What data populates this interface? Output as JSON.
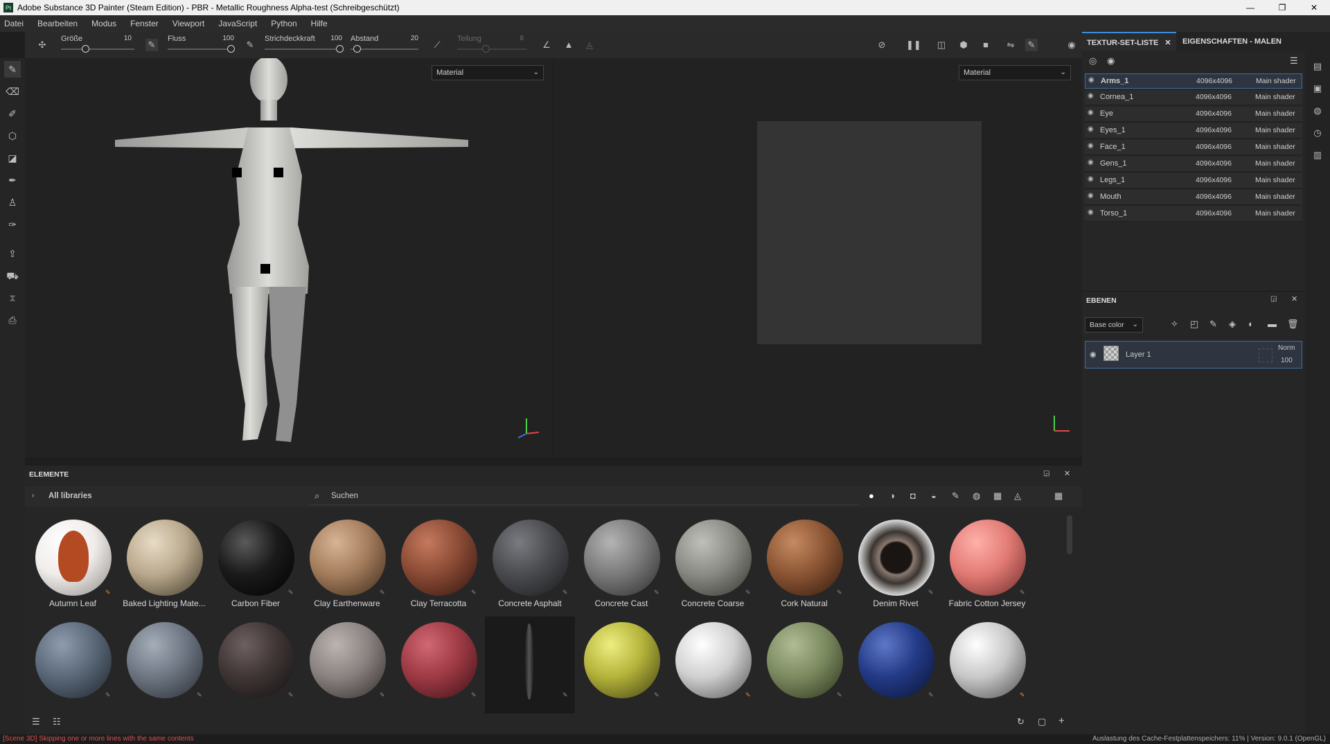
{
  "window": {
    "app_icon": "Pt",
    "title": "Adobe Substance 3D Painter (Steam Edition) - PBR - Metallic Roughness Alpha-test (Schreibgeschützt)",
    "controls": [
      "—",
      "❐",
      "✕"
    ]
  },
  "menu": [
    "Datei",
    "Bearbeiten",
    "Modus",
    "Fenster",
    "Viewport",
    "JavaScript",
    "Python",
    "Hilfe"
  ],
  "toolbar": {
    "size_label": "Größe",
    "size_value": "10",
    "flow_label": "Fluss",
    "flow_value": "100",
    "opacity_label": "Strichdeckkraft",
    "opacity_value": "100",
    "spacing_label": "Abstand",
    "spacing_value": "20",
    "division_label": "Teilung",
    "division_value": "8"
  },
  "viewport3d": {
    "material_select": "Material"
  },
  "viewport2d": {
    "material_select": "Material"
  },
  "texture_set_list": {
    "tab_label": "TEXTUR-SET-LISTE",
    "properties_tab_label": "EIGENSCHAFTEN - MALEN",
    "rows": [
      {
        "name": "Arms_1",
        "resolution": "4096x4096",
        "shader": "Main shader",
        "selected": true
      },
      {
        "name": "Cornea_1",
        "resolution": "4096x4096",
        "shader": "Main shader",
        "selected": false
      },
      {
        "name": "Eye",
        "resolution": "4096x4096",
        "shader": "Main shader",
        "selected": false
      },
      {
        "name": "Eyes_1",
        "resolution": "4096x4096",
        "shader": "Main shader",
        "selected": false
      },
      {
        "name": "Face_1",
        "resolution": "4096x4096",
        "shader": "Main shader",
        "selected": false
      },
      {
        "name": "Gens_1",
        "resolution": "4096x4096",
        "shader": "Main shader",
        "selected": false
      },
      {
        "name": "Legs_1",
        "resolution": "4096x4096",
        "shader": "Main shader",
        "selected": false
      },
      {
        "name": "Mouth",
        "resolution": "4096x4096",
        "shader": "Main shader",
        "selected": false
      },
      {
        "name": "Torso_1",
        "resolution": "4096x4096",
        "shader": "Main shader",
        "selected": false
      }
    ]
  },
  "layers": {
    "header": "EBENEN",
    "channel_select": "Base color",
    "items": [
      {
        "name": "Layer 1",
        "blend": "Norm",
        "opacity": "100"
      }
    ]
  },
  "assets": {
    "header": "ELEMENTE",
    "library": "All libraries",
    "search_placeholder": "Suchen",
    "row1": [
      {
        "name": "Autumn Leaf",
        "color": "#f0ecea",
        "accent": "#b44a22",
        "badge": "orange"
      },
      {
        "name": "Baked Lighting Mate...",
        "color": "#b9a88c",
        "badge": "none"
      },
      {
        "name": "Carbon Fiber",
        "color": "#1a1a1a",
        "badge": "gray"
      },
      {
        "name": "Clay Earthenware",
        "color": "#a37c5c",
        "badge": "gray"
      },
      {
        "name": "Clay Terracotta",
        "color": "#8a4a34",
        "badge": "gray"
      },
      {
        "name": "Concrete Asphalt",
        "color": "#4a4b4f",
        "badge": "gray"
      },
      {
        "name": "Concrete Cast",
        "color": "#7a7a7a",
        "badge": "gray"
      },
      {
        "name": "Concrete Coarse",
        "color": "#8a8a84",
        "badge": "gray"
      },
      {
        "name": "Cork Natural",
        "color": "#8b5534",
        "badge": "gray"
      },
      {
        "name": "Denim Rivet",
        "color": "#3a3430",
        "badge": "gray"
      },
      {
        "name": "Fabric Cotton Jersey",
        "color": "#e27a74",
        "badge": "gray"
      }
    ],
    "row2": [
      {
        "color": "#5a6878",
        "badge": "gray"
      },
      {
        "color": "#6d7682",
        "badge": "gray"
      },
      {
        "color": "#3f3535",
        "badge": "gray"
      },
      {
        "color": "#8a8280",
        "badge": "gray"
      },
      {
        "color": "#9e3a44",
        "badge": "gray"
      },
      {
        "color": "#2a2a2a",
        "badge": "gray"
      },
      {
        "color": "#b3b23a",
        "badge": "gray"
      },
      {
        "color": "#d0d0d0",
        "badge": "orange"
      },
      {
        "color": "#7c8a60",
        "badge": "gray"
      },
      {
        "color": "#233a86",
        "badge": "gray"
      },
      {
        "color": "#c8c8c8",
        "badge": "orange"
      }
    ]
  },
  "status": {
    "left": "[Scene 3D] Skipping one or more lines with the same contents",
    "right": "Auslastung des Cache-Festplattenspeichers:   11% | Version: 9.0.1 (OpenGL)"
  },
  "colors": {
    "accent": "#3b8ddd",
    "error": "#e05050"
  }
}
